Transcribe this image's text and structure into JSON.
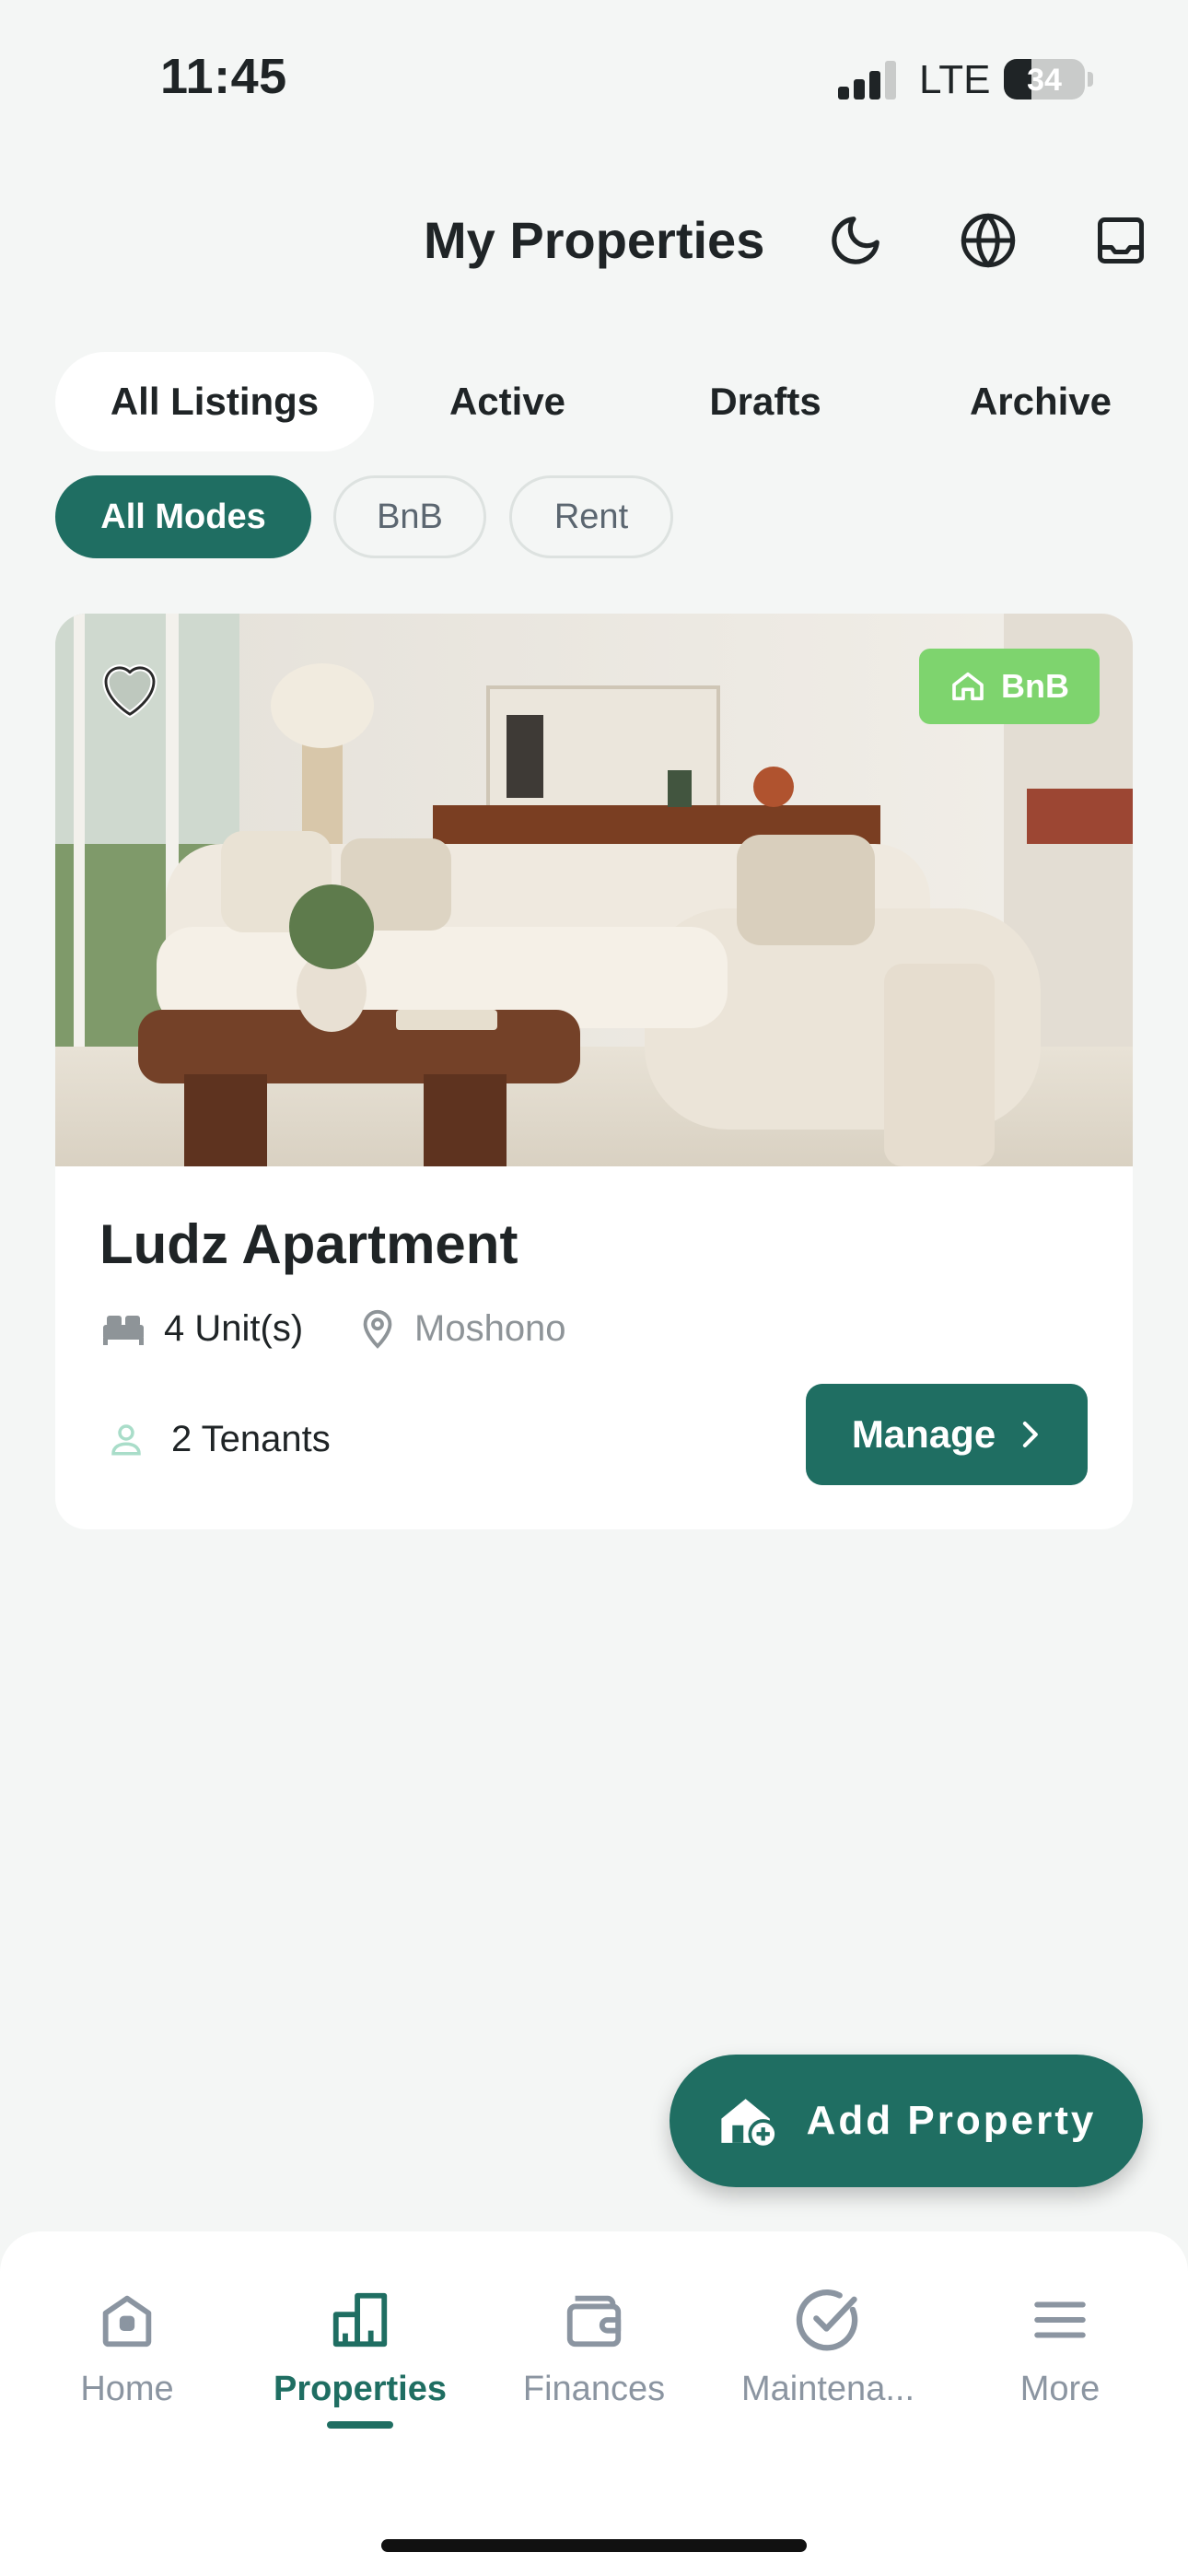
{
  "status_bar": {
    "time": "11:45",
    "network": "LTE",
    "battery": "34"
  },
  "header": {
    "title": "My Properties",
    "icons": [
      "moon-icon",
      "globe-icon",
      "inbox-icon"
    ]
  },
  "tabs": [
    {
      "label": "All Listings",
      "active": true
    },
    {
      "label": "Active",
      "active": false
    },
    {
      "label": "Drafts",
      "active": false
    },
    {
      "label": "Archive",
      "active": false
    }
  ],
  "modes": [
    {
      "label": "All Modes",
      "active": true
    },
    {
      "label": "BnB",
      "active": false
    },
    {
      "label": "Rent",
      "active": false
    }
  ],
  "property": {
    "name": "Ludz Apartment",
    "badge": "BnB",
    "units": "4 Unit(s)",
    "location": "Moshono",
    "tenants": "2 Tenants",
    "manage_label": "Manage",
    "image": "living-room-photo"
  },
  "fab": {
    "label": "Add Property"
  },
  "nav": [
    {
      "label": "Home",
      "icon": "home-icon",
      "active": false
    },
    {
      "label": "Properties",
      "icon": "buildings-icon",
      "active": true
    },
    {
      "label": "Finances",
      "icon": "wallet-icon",
      "active": false
    },
    {
      "label": "Maintena...",
      "icon": "check-circle-icon",
      "active": false
    },
    {
      "label": "More",
      "icon": "menu-icon",
      "active": false
    }
  ],
  "colors": {
    "primary": "#1f6e62",
    "badge_green": "#7ed46e",
    "background": "#f4f6f5",
    "muted": "#8b95a1"
  }
}
